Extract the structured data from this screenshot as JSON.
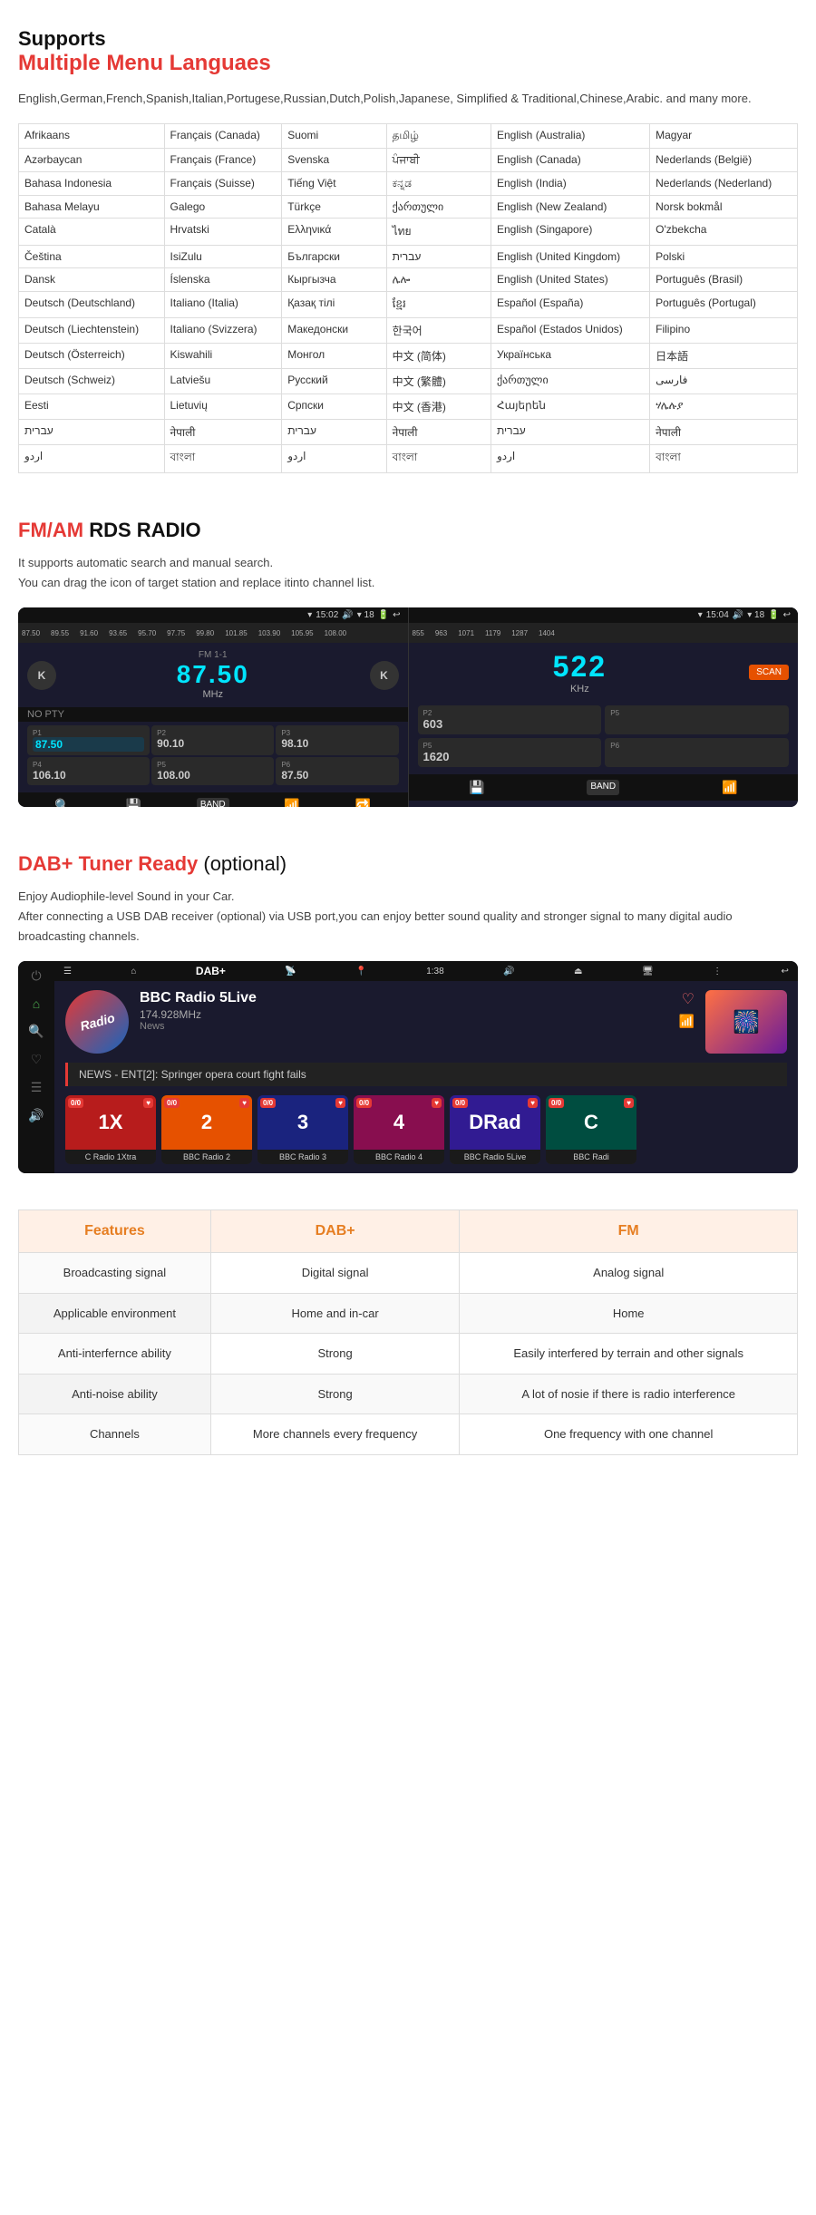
{
  "languages_section": {
    "title_black": "Supports",
    "title_red": "Multiple Menu Languaes",
    "subtitle": "English,German,French,Spanish,Italian,Portugese,Russian,Dutch,Polish,Japanese, Simplified & Traditional,Chinese,Arabic. and many more.",
    "table": [
      [
        "Afrikaans",
        "Français (Canada)",
        "Suomi",
        "தமிழ்",
        "English (Australia)",
        "Magyar"
      ],
      [
        "Azərbaycan",
        "Français (France)",
        "Svenska",
        "ਪੰਜਾਬੀ",
        "English (Canada)",
        "Nederlands (België)"
      ],
      [
        "Bahasa Indonesia",
        "Français (Suisse)",
        "Tiếng Việt",
        "ಕನ್ನಡ",
        "English (India)",
        "Nederlands (Nederland)"
      ],
      [
        "Bahasa Melayu",
        "Galego",
        "Türkçe",
        "ქართული",
        "English (New Zealand)",
        "Norsk bokmål"
      ],
      [
        "Català",
        "Hrvatski",
        "Ελληνικά",
        "ไทย",
        "English (Singapore)",
        "O'zbekcha"
      ],
      [
        "Čeština",
        "IsiZulu",
        "Български",
        "עברית",
        "English (United Kingdom)",
        "Polski"
      ],
      [
        "Dansk",
        "Íslenska",
        "Кыргызча",
        "ሌሎ",
        "English (United States)",
        "Português (Brasil)"
      ],
      [
        "Deutsch (Deutschland)",
        "Italiano (Italia)",
        "Қазақ тілі",
        "ខ្មែរ",
        "Español (España)",
        "Português (Portugal)"
      ],
      [
        "Deutsch (Liechtenstein)",
        "Italiano (Svizzera)",
        "Македонски",
        "한국어",
        "Español (Estados Unidos)",
        "Filipino"
      ],
      [
        "Deutsch (Österreich)",
        "Kiswahili",
        "Монгол",
        "中文 (简体)",
        "Українська",
        "日本語"
      ],
      [
        "Deutsch (Schweiz)",
        "Latviešu",
        "Русский",
        "中文 (繁體)",
        "ქართული",
        "فارسی"
      ],
      [
        "Eesti",
        "Lietuvių",
        "Српски",
        "中文 (香港)",
        "Հայերեն",
        "ሃሌሉያ"
      ],
      [
        "עברית",
        "नेपाली",
        "עברית",
        "नेपाली",
        "עברית",
        "नेपाली"
      ],
      [
        "اردو",
        "বাংলা",
        "اردو",
        "বাংলা",
        "اردو",
        "বাংলা"
      ]
    ]
  },
  "radio_section": {
    "title_red": "FM/AM",
    "title_black": "RDS RADIO",
    "description_line1": "It supports automatic search and manual search.",
    "description_line2": "You can drag the icon of target station and replace itinto channel list.",
    "left_panel": {
      "status_time": "15:02",
      "status_signal": "▾ 18",
      "station_id": "FM 1-1",
      "frequency": "87.50",
      "unit": "MHz",
      "prev_btn": "K",
      "next_btn": "K",
      "pty": "NO PTY",
      "ruler_marks": [
        "87.50",
        "89.55",
        "91.60",
        "93.65",
        "95.70",
        "97.75",
        "99.80",
        "101.85",
        "103.90",
        "105.95",
        "108.00"
      ],
      "presets": [
        {
          "num": "P1",
          "freq": "87.50",
          "active": true
        },
        {
          "num": "P2",
          "freq": "90.10",
          "active": false
        },
        {
          "num": "P3",
          "freq": "98.10",
          "active": false
        },
        {
          "num": "P4",
          "freq": "106.10",
          "active": false
        },
        {
          "num": "P5",
          "freq": "108.00",
          "active": false
        },
        {
          "num": "P6",
          "freq": "87.50",
          "active": false
        }
      ]
    },
    "right_panel": {
      "status_time": "15:04",
      "status_signal": "▾ 18",
      "frequency": "522",
      "unit": "KHz",
      "scan_btn": "SCAN",
      "ruler_marks": [
        "855",
        "963",
        "1071",
        "1179",
        "1287",
        "1404"
      ],
      "presets": [
        {
          "num": "P2",
          "freq": "603",
          "active": false
        },
        {
          "num": "P5",
          "freq": "",
          "active": false
        },
        {
          "num": "P5",
          "freq": "1620",
          "active": false
        },
        {
          "num": "P6",
          "freq": "",
          "active": false
        }
      ]
    }
  },
  "dab_section": {
    "title_red": "DAB+ Tuner Ready",
    "title_optional": "(optional)",
    "desc_line1": "Enjoy Audiophile-level Sound in your Car.",
    "desc_line2": "After connecting a USB DAB receiver (optional) via USB port,you can enjoy better sound quality and stronger signal to many digital audio broadcasting channels.",
    "screenshot": {
      "status_time": "1:38",
      "nav_title": "DAB+",
      "station_name": "BBC Radio 5Live",
      "station_freq": "174.928MHz",
      "station_genre": "News",
      "news_ticker": "NEWS - ENT[2]: Springer opera court fight fails",
      "channels": [
        {
          "name": "C Radio 1Xtra",
          "label": "1X",
          "color": "#b71c1c",
          "badge": "0/0"
        },
        {
          "name": "BBC Radio 2",
          "label": "2",
          "color": "#e65100",
          "badge": "0/0"
        },
        {
          "name": "BBC Radio 3",
          "label": "3",
          "color": "#1a237e",
          "badge": "0/0"
        },
        {
          "name": "BBC Radio 4",
          "label": "4",
          "color": "#880e4f",
          "badge": "0/0"
        },
        {
          "name": "BBC Radio 5Live",
          "label": "DRad",
          "color": "#311b92",
          "badge": "0/0"
        },
        {
          "name": "BBC Radi",
          "label": "C",
          "color": "#004d40",
          "badge": "0/0"
        }
      ]
    }
  },
  "comparison_section": {
    "headers": [
      "Features",
      "DAB+",
      "FM"
    ],
    "rows": [
      [
        "Broadcasting signal",
        "Digital signal",
        "Analog signal"
      ],
      [
        "Applicable environment",
        "Home and in-car",
        "Home"
      ],
      [
        "Anti-interfernce ability",
        "Strong",
        "Easily interfered by terrain and other signals"
      ],
      [
        "Anti-noise ability",
        "Strong",
        "A lot of nosie if there is radio interference"
      ],
      [
        "Channels",
        "More channels every frequency",
        "One frequency with one channel"
      ]
    ]
  }
}
